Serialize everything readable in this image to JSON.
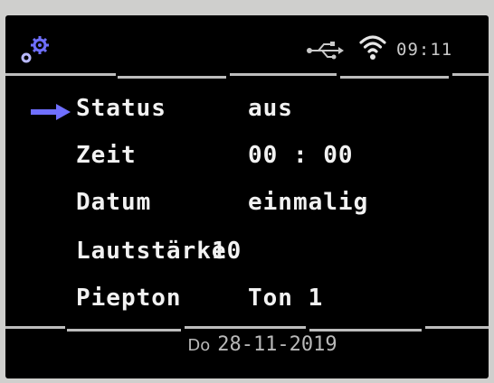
{
  "status_bar": {
    "time": "09:11",
    "icons": [
      "gear-icon",
      "usb-icon",
      "wifi-icon"
    ]
  },
  "menu": {
    "items": [
      {
        "label": "Status",
        "value": "aus",
        "selected": true
      },
      {
        "label": "Zeit",
        "value": "00 : 00",
        "selected": false
      },
      {
        "label": "Datum",
        "value": "einmalig",
        "selected": false
      },
      {
        "label": "Lautstärke",
        "value": "10",
        "selected": false
      },
      {
        "label": "Piepton",
        "value": "Ton 1",
        "selected": false
      }
    ]
  },
  "footer": {
    "weekday": "Do",
    "date": "28-11-2019"
  },
  "colors": {
    "screen": "#000000",
    "text": "#f2f2f2",
    "cursor": "#6f6fff"
  }
}
